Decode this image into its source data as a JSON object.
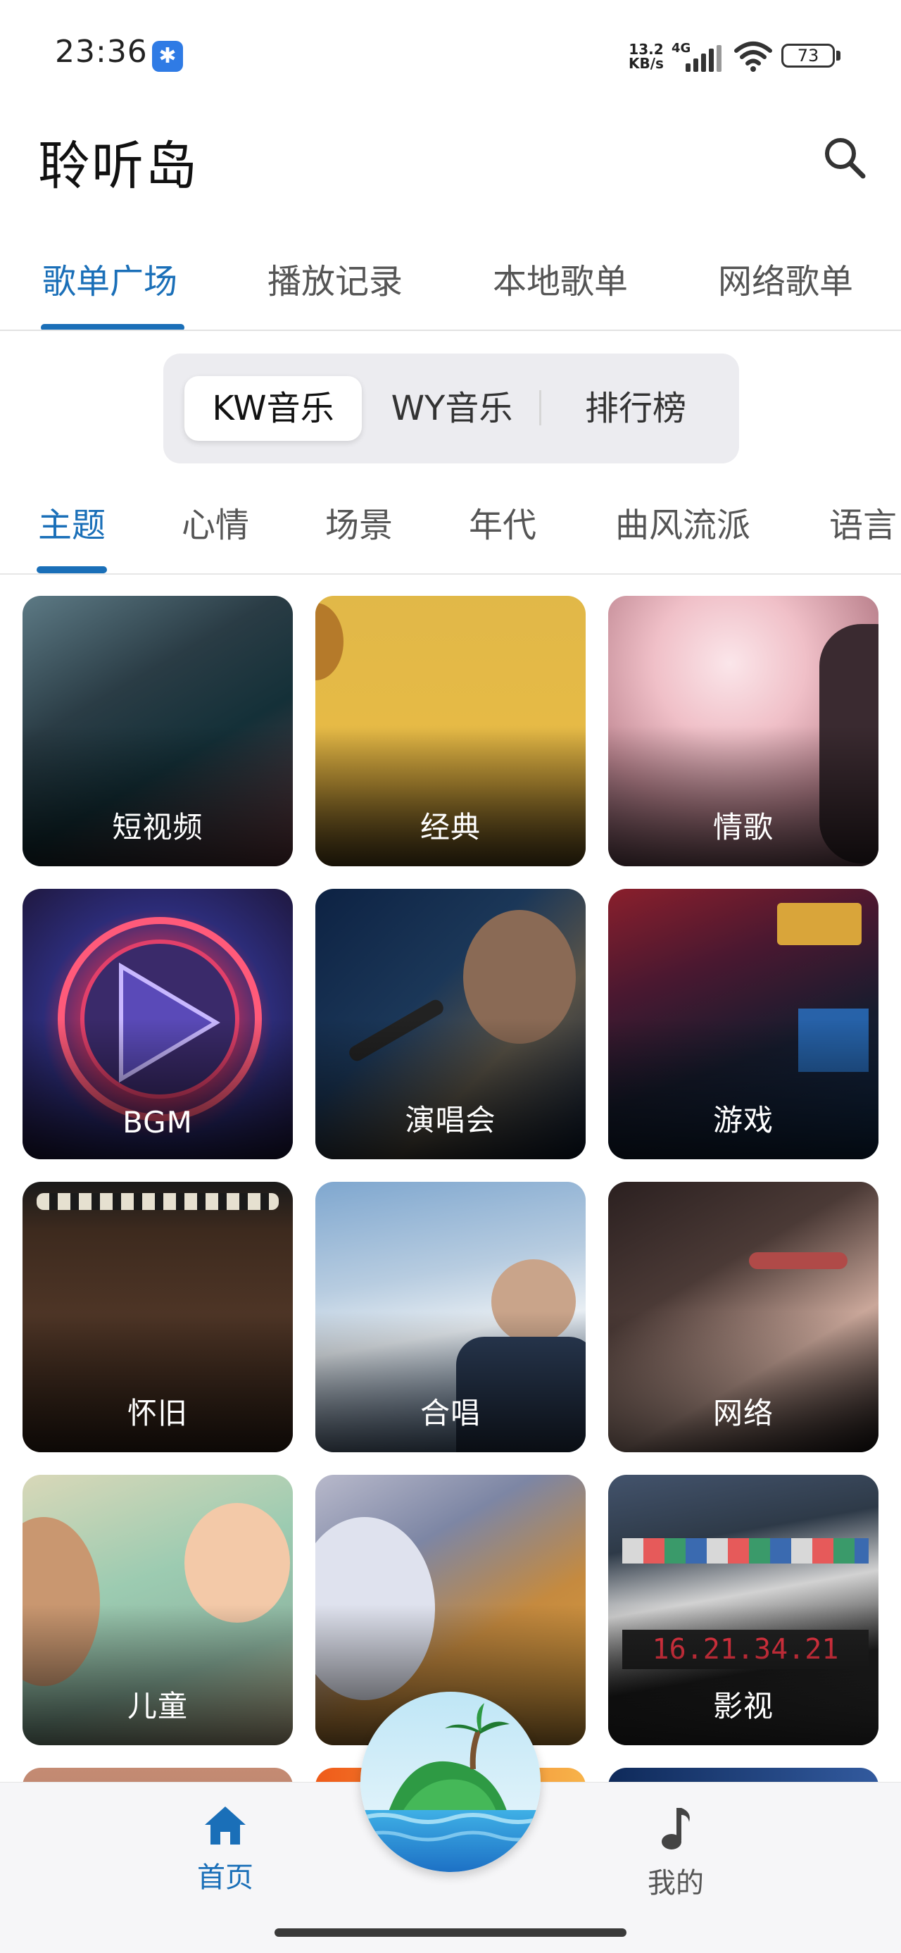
{
  "status_bar": {
    "time": "23:36",
    "notification_icon": "star-badge-icon",
    "net_speed_value": "13.2",
    "net_speed_unit": "KB/s",
    "network_type": "4G",
    "battery": "73"
  },
  "header": {
    "title": "聆听岛",
    "search_icon": "search-icon"
  },
  "main_tabs": [
    {
      "label": "歌单广场",
      "active": true
    },
    {
      "label": "播放记录",
      "active": false
    },
    {
      "label": "本地歌单",
      "active": false
    },
    {
      "label": "网络歌单",
      "active": false
    }
  ],
  "sources": [
    {
      "label": "KW音乐",
      "active": true
    },
    {
      "label": "WY音乐",
      "active": false
    },
    {
      "label": "排行榜",
      "active": false
    }
  ],
  "category_tabs": [
    {
      "label": "主题",
      "active": true
    },
    {
      "label": "心情",
      "active": false
    },
    {
      "label": "场景",
      "active": false
    },
    {
      "label": "年代",
      "active": false
    },
    {
      "label": "曲风流派",
      "active": false
    },
    {
      "label": "语言",
      "active": false
    }
  ],
  "playlists": [
    {
      "label": "短视频"
    },
    {
      "label": "经典"
    },
    {
      "label": "情歌"
    },
    {
      "label": "BGM"
    },
    {
      "label": "演唱会"
    },
    {
      "label": "游戏"
    },
    {
      "label": "怀旧"
    },
    {
      "label": "合唱"
    },
    {
      "label": "网络"
    },
    {
      "label": "儿童"
    },
    {
      "label": ""
    },
    {
      "label": "影视"
    }
  ],
  "bottom_nav": {
    "home_label": "首页",
    "home_icon": "home-icon",
    "mine_label": "我的",
    "mine_icon": "music-note-icon",
    "center_icon": "island-logo-icon"
  },
  "colors": {
    "accent": "#1a6fb8",
    "segment_bg": "#ececf0"
  }
}
